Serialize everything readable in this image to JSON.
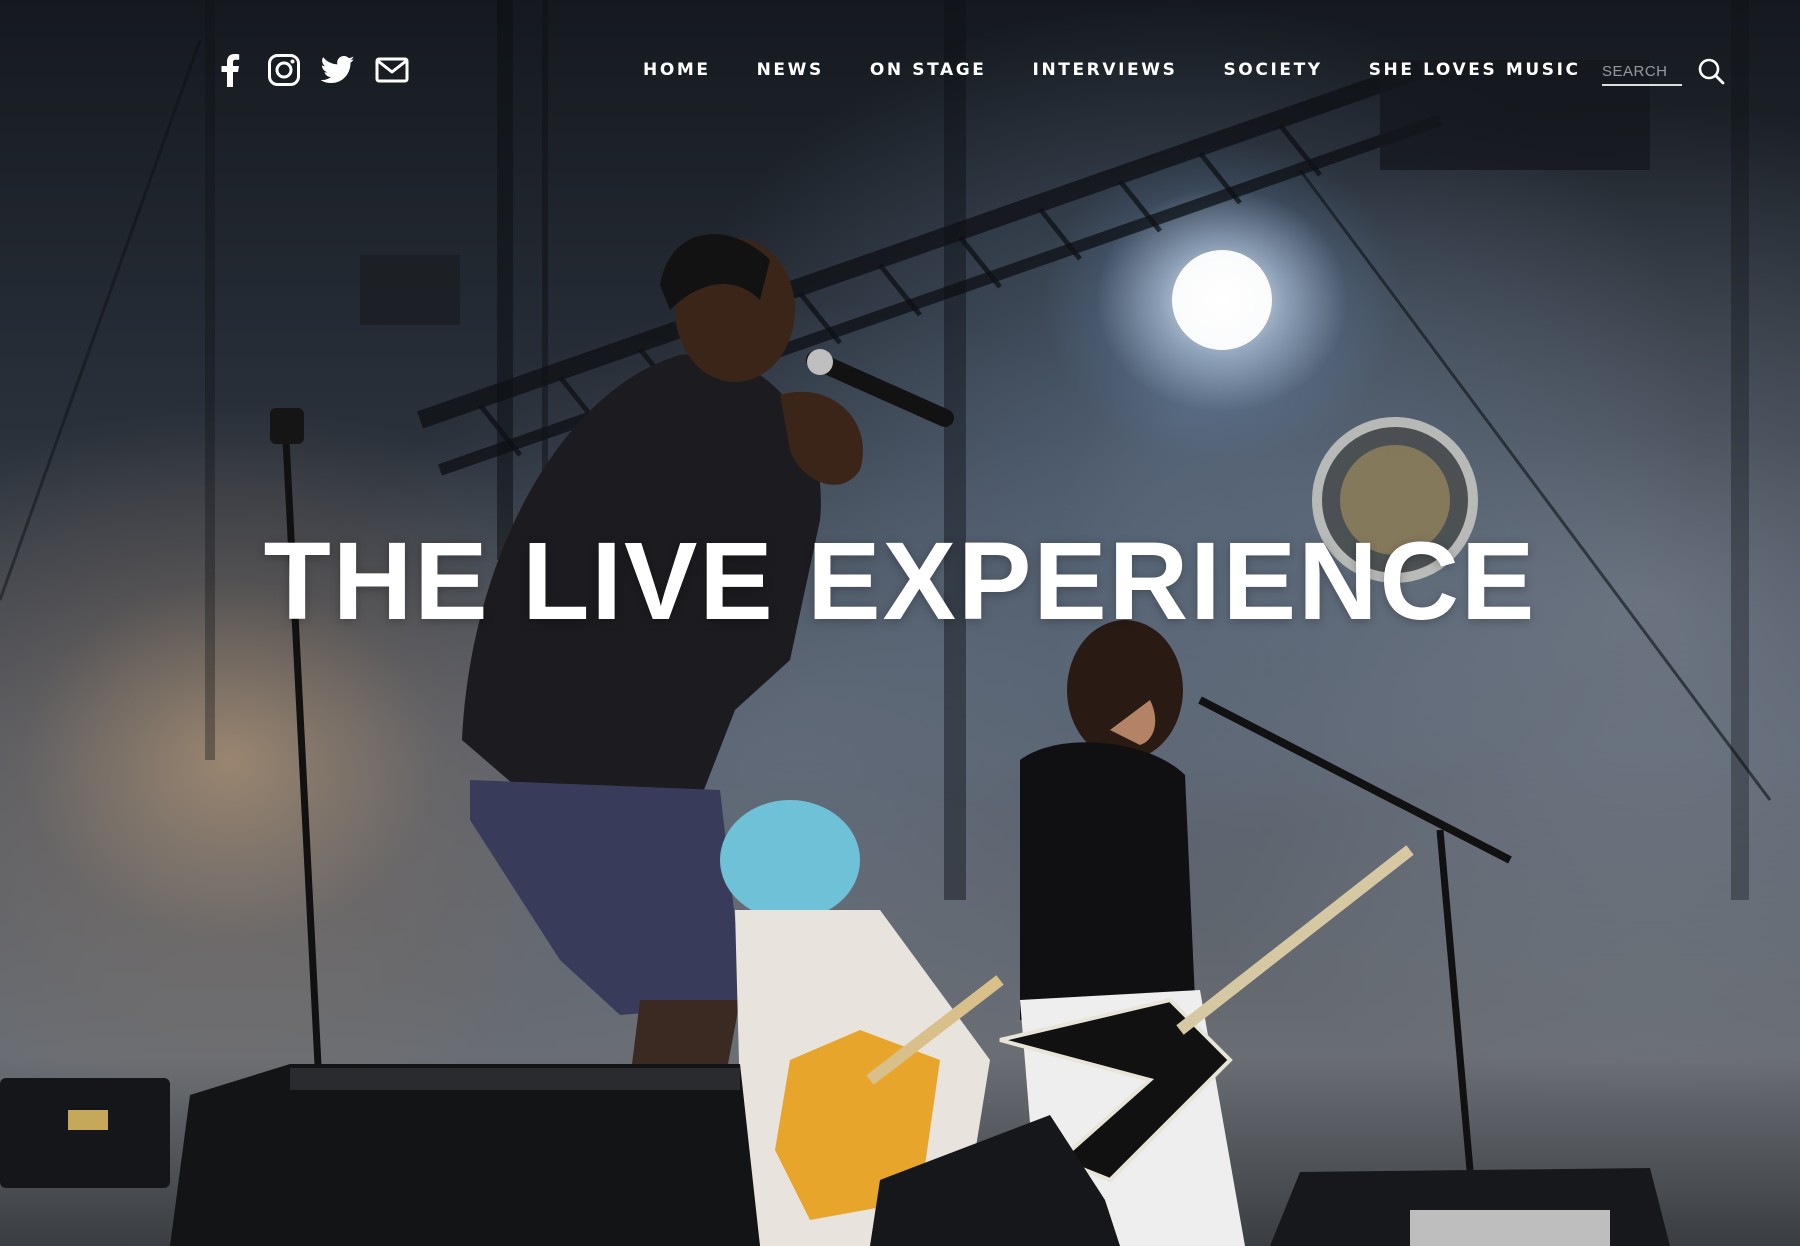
{
  "header": {
    "social": [
      {
        "name": "facebook-icon",
        "label": "Facebook"
      },
      {
        "name": "instagram-icon",
        "label": "Instagram"
      },
      {
        "name": "twitter-icon",
        "label": "Twitter"
      },
      {
        "name": "mail-icon",
        "label": "Email"
      }
    ],
    "nav": [
      {
        "label": "HOME"
      },
      {
        "label": "NEWS"
      },
      {
        "label": "ON STAGE"
      },
      {
        "label": "INTERVIEWS"
      },
      {
        "label": "SOCIETY"
      },
      {
        "label": "SHE LOVES MUSIC"
      }
    ],
    "search": {
      "placeholder": "SEARCH",
      "value": "",
      "icon": "search-icon"
    }
  },
  "hero": {
    "title": "THE LIVE EXPERIENCE",
    "background": "concert-stage-photo"
  },
  "colors": {
    "text": "#ffffff",
    "stage_light": "#eaf3ff",
    "smoke_warm": "#d6aa78"
  }
}
